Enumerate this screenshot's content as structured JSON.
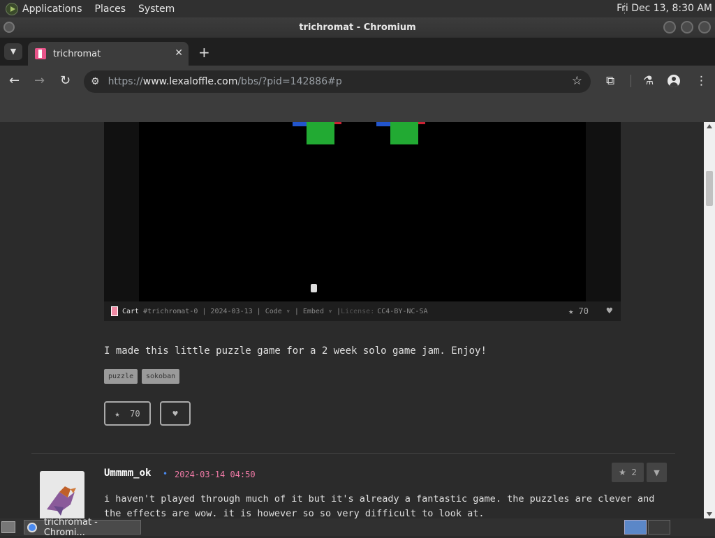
{
  "top_panel": {
    "menus": [
      "Applications",
      "Places",
      "System"
    ],
    "clock": "Fri Dec 13,  8:30 AM"
  },
  "window": {
    "title": "trichromat - Chromium"
  },
  "tab": {
    "title": "trichromat",
    "close": "✕",
    "new_tab": "+"
  },
  "toolbar": {
    "back": "←",
    "forward": "→",
    "reload": "↻",
    "url_prefix": "https://",
    "url_host": "www.lexaloffle.com",
    "url_path": "/bbs/?pid=142886#p",
    "star": "☆",
    "extensions": "⧉",
    "labs": "⚗",
    "menu": "⋮"
  },
  "cart": {
    "label": "Cart",
    "meta": "#trichromat-0 | 2024-03-13 | Code ▿ | Embed ▿ | ",
    "license_label": "License:",
    "license": "CC4-BY-NC-SA",
    "likes": "70"
  },
  "post": {
    "text": "I made this little puzzle game for a 2 week solo game jam. Enjoy!",
    "tags": [
      "puzzle",
      "sokoban"
    ],
    "like_count": "70"
  },
  "comment": {
    "author": "Ummmm_ok",
    "dot": "•",
    "date": "2024-03-14 04:50",
    "votes": "2",
    "text": "i haven't played through much of it but it's already a fantastic game. the puzzles are clever and the effects are wow. it is however so so very difficult to look at."
  },
  "taskbar": {
    "task_label": "trichromat - Chromi..."
  },
  "colors": {
    "accent_date": "#f07aa6",
    "author_dot": "#4a8af0",
    "block_green": "#22aa33",
    "block_blue": "#2255cc",
    "block_red": "#cc2233"
  }
}
